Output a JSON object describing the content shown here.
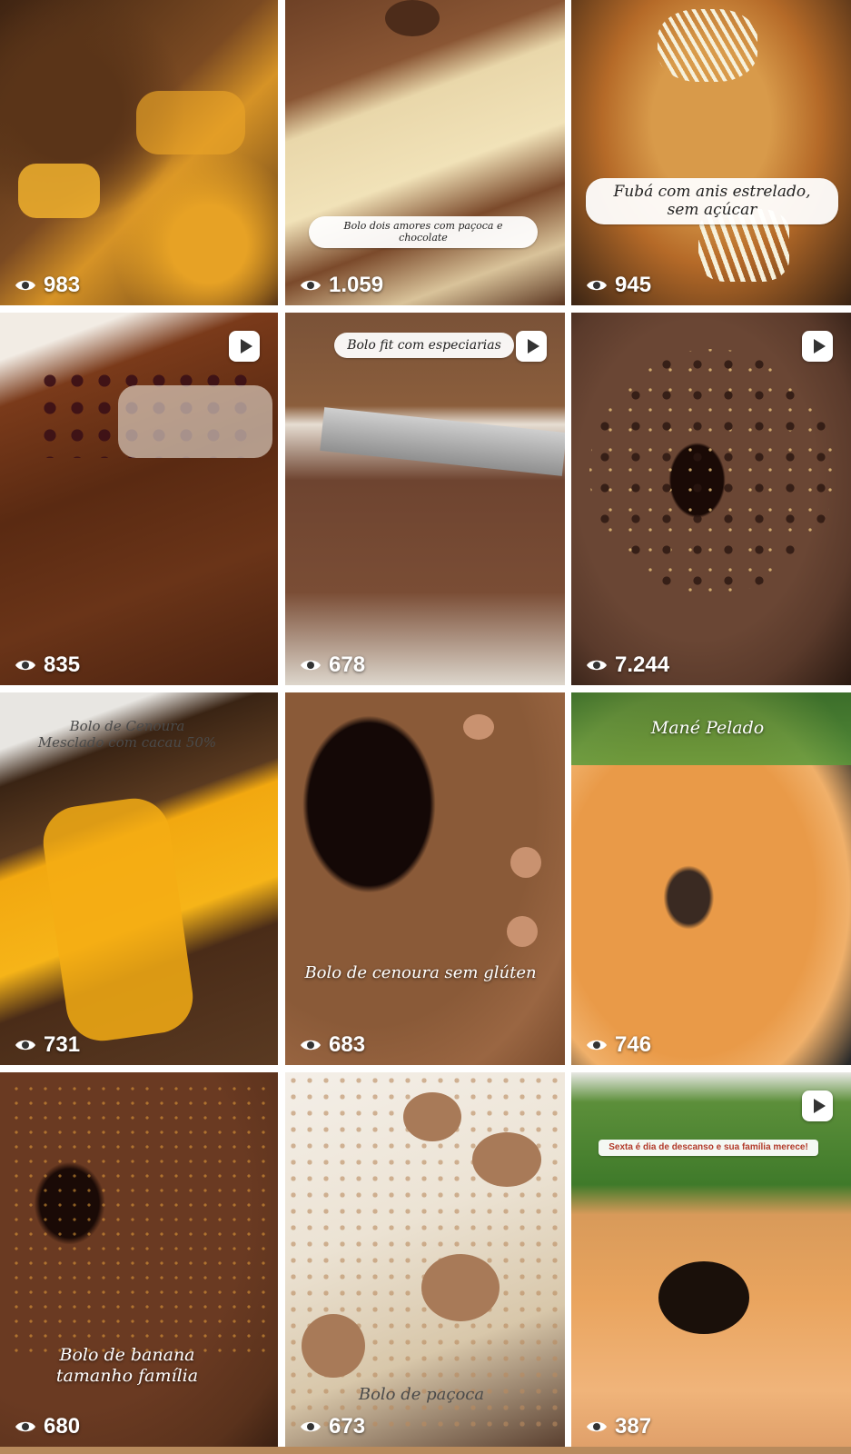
{
  "grid": {
    "tiles": [
      {
        "views": "983",
        "caption": "",
        "reel": false
      },
      {
        "views": "1.059",
        "caption": "Bolo dois amores com paçoca e chocolate",
        "reel": false
      },
      {
        "views": "945",
        "caption": "Fubá com anis estrelado, sem açúcar",
        "reel": false
      },
      {
        "views": "835",
        "caption": "",
        "reel": true
      },
      {
        "views": "678",
        "caption": "Bolo fit com especiarias",
        "reel": true
      },
      {
        "views": "7.244",
        "caption": "",
        "reel": true
      },
      {
        "views": "731",
        "caption": "Bolo de Cenoura Mesclado com cacau 50%",
        "reel": false
      },
      {
        "views": "683",
        "caption": "Bolo de cenoura sem glúten",
        "reel": false
      },
      {
        "views": "746",
        "caption": "Mané Pelado",
        "reel": false
      },
      {
        "views": "680",
        "caption": "Bolo de banana tamanho família",
        "reel": false
      },
      {
        "views": "673",
        "caption": "Bolo de paçoca",
        "reel": false
      },
      {
        "views": "387",
        "caption": "Sexta é dia de descanso e sua família merece!",
        "reel": true
      }
    ]
  },
  "icons": {
    "views": "eye-icon",
    "reel": "reel-play-icon"
  },
  "colors": {
    "background": "#ffffff",
    "overlay_text": "#ffffff"
  }
}
